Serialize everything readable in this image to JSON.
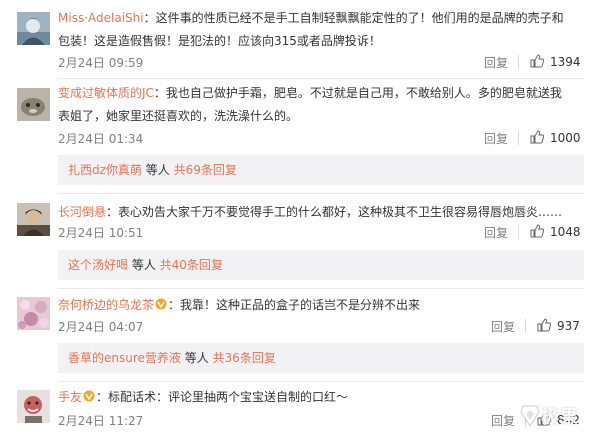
{
  "comments": [
    {
      "username": "Miss·AdelaiShi",
      "text": "：这件事的性质已经不是手工自制轻飘飘能定性的了！他们用的是品牌的壳子和包装！这是造假售假！是犯法的！应该向315或者品牌投诉！",
      "time": "2月24日 09:59",
      "reply_label": "回复",
      "likes": "1394"
    },
    {
      "username": "变成过敏体质的JC",
      "text": "：我也自己做护手霜，肥皂。不过就是自己用，不敢给别人。多的肥皂就送我表姐了，她家里还挺喜欢的，洗洗澡什么的。",
      "time": "2月24日 01:34",
      "reply_label": "回复",
      "likes": "1000",
      "sub_reply": {
        "name": "扎西dz你真萌",
        "middle": " 等人 ",
        "count": "共69条回复"
      }
    },
    {
      "username": "长河倒悬",
      "text": "：表心劝告大家千万不要觉得手工的什么都好，这种极其不卫生很容易得唇炮唇炎……",
      "time": "2月24日 10:51",
      "reply_label": "回复",
      "likes": "1048",
      "sub_reply": {
        "name": "这个汤好喝",
        "middle": " 等人 ",
        "count": "共40条回复"
      }
    },
    {
      "username": "奈何桥边的乌龙茶",
      "text": "：我靠！这种正品的盒子的话岂不是分辨不出来",
      "time": "2月24日 04:07",
      "reply_label": "回复",
      "likes": "937",
      "sub_reply": {
        "name": "香草的ensure营养液",
        "middle": " 等人 ",
        "count": "共36条回复"
      }
    },
    {
      "username": "手友",
      "text": "：标配话术：评论里抽两个宝宝送自制的口红～",
      "time": "2月24日 11:27",
      "reply_label": "回复",
      "likes": "842"
    }
  ],
  "watermark": {
    "text": "极果"
  },
  "colors": {
    "username": "#eb7350",
    "meta": "#808080",
    "sub_bg": "#f2f2f5"
  }
}
